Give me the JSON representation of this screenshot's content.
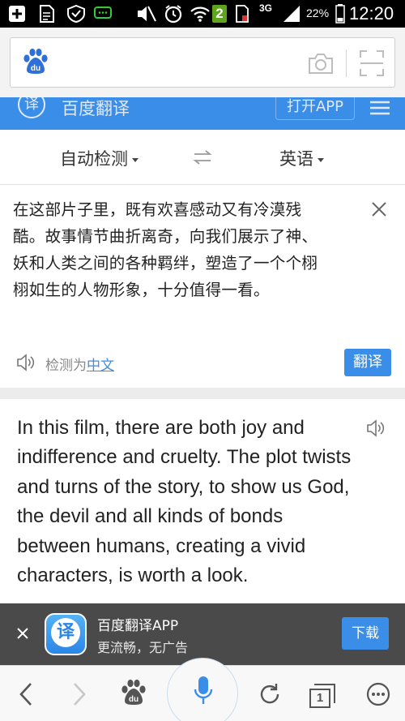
{
  "status_bar": {
    "battery_percent": "22%",
    "time": "12:20",
    "network": "3G",
    "sim_badge": "2",
    "icons": [
      "add-icon",
      "file-icon",
      "shield-icon",
      "chat-icon",
      "mute-icon",
      "alarm-icon",
      "wifi-icon",
      "sim-icon",
      "signal-icon",
      "battery-icon"
    ]
  },
  "browser": {
    "logo": "baidu-paw-icon",
    "camera_icon": "camera-icon",
    "scan_icon": "scan-icon"
  },
  "header": {
    "logo_char": "译",
    "title": "百度翻译",
    "open_app": "打开APP",
    "menu_icon": "menu-icon"
  },
  "languages": {
    "source": "自动检测",
    "swap_icon": "swap-icon",
    "target": "英语"
  },
  "input": {
    "text": "在这部片子里，既有欢喜感动又有冷漠残酷。故事情节曲折离奇，向我们展示了神、妖和人类之间的各种羁绊，塑造了一个个栩栩如生的人物形象，十分值得一看。",
    "detected_prefix": "检测为",
    "detected_lang": "中文",
    "translate_button": "翻译"
  },
  "result": {
    "text": "In this film, there are both joy and indifference and cruelty. The plot twists and turns of the story, to show us God, the devil and all kinds of bonds between humans, creating a vivid characters, is worth a look."
  },
  "promo": {
    "app_name": "百度翻译APP",
    "tagline": "更流畅，无广告",
    "download": "下载",
    "icon_char": "译"
  },
  "bottom_nav": {
    "tab_count": "1"
  },
  "colors": {
    "brand_blue": "#3b8ee8",
    "promo_bg": "#4a4a4a"
  }
}
